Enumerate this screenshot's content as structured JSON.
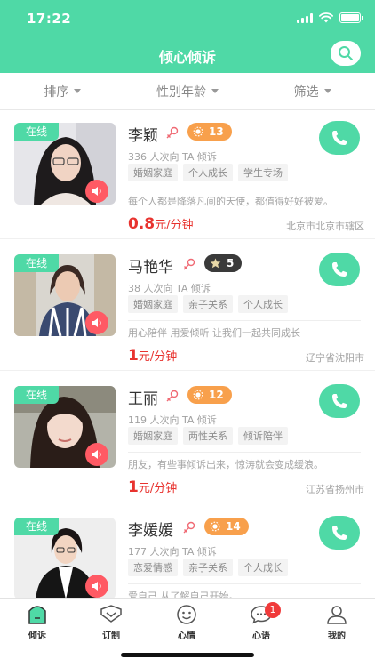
{
  "status_bar": {
    "time": "17:22",
    "battery_level": 1.0
  },
  "header": {
    "title": "倾心倾诉"
  },
  "filters": [
    {
      "label": "排序"
    },
    {
      "label": "性别年龄"
    },
    {
      "label": "筛选"
    }
  ],
  "status_label": "在线",
  "counselors": [
    {
      "name": "李颖",
      "level": "13",
      "level_style": "orange",
      "consult_count": "336 人次向 TA 倾诉",
      "tags": [
        "婚姻家庭",
        "个人成长",
        "学生专场"
      ],
      "motto": "每个人都是降落凡间的天使，都值得好好被爱。",
      "price_value": "0.8",
      "price_unit": "元/分钟",
      "location": "北京市北京市辖区"
    },
    {
      "name": "马艳华",
      "level": "5",
      "level_style": "dark",
      "consult_count": "38 人次向 TA 倾诉",
      "tags": [
        "婚姻家庭",
        "亲子关系",
        "个人成长"
      ],
      "motto": "用心陪伴  用爱倾听   让我们一起共同成长",
      "price_value": "1",
      "price_unit": "元/分钟",
      "location": "辽宁省沈阳市"
    },
    {
      "name": "王丽",
      "level": "12",
      "level_style": "orange",
      "consult_count": "119 人次向 TA 倾诉",
      "tags": [
        "婚姻家庭",
        "两性关系",
        "倾诉陪伴"
      ],
      "motto": "朋友，有些事倾诉出来，惊涛就会变成缓浪。",
      "price_value": "1",
      "price_unit": "元/分钟",
      "location": "江苏省扬州市"
    },
    {
      "name": "李媛媛",
      "level": "14",
      "level_style": "orange",
      "consult_count": "177 人次向 TA 倾诉",
      "tags": [
        "恋爱情感",
        "亲子关系",
        "个人成长"
      ],
      "motto": "爱自己  从了解自己开始。",
      "price_value": "",
      "price_unit": "",
      "location": ""
    }
  ],
  "tabs": [
    {
      "label": "倾诉",
      "icon": "listen-icon"
    },
    {
      "label": "订制",
      "icon": "customize-icon"
    },
    {
      "label": "心情",
      "icon": "mood-icon"
    },
    {
      "label": "心语",
      "icon": "message-icon",
      "badge": "1"
    },
    {
      "label": "我的",
      "icon": "profile-icon"
    }
  ],
  "colors": {
    "primary": "#4fd9a6",
    "price": "#e8332f",
    "voice": "#ff5a64",
    "level": "#f8a04c",
    "badge": "#f03a3a"
  }
}
